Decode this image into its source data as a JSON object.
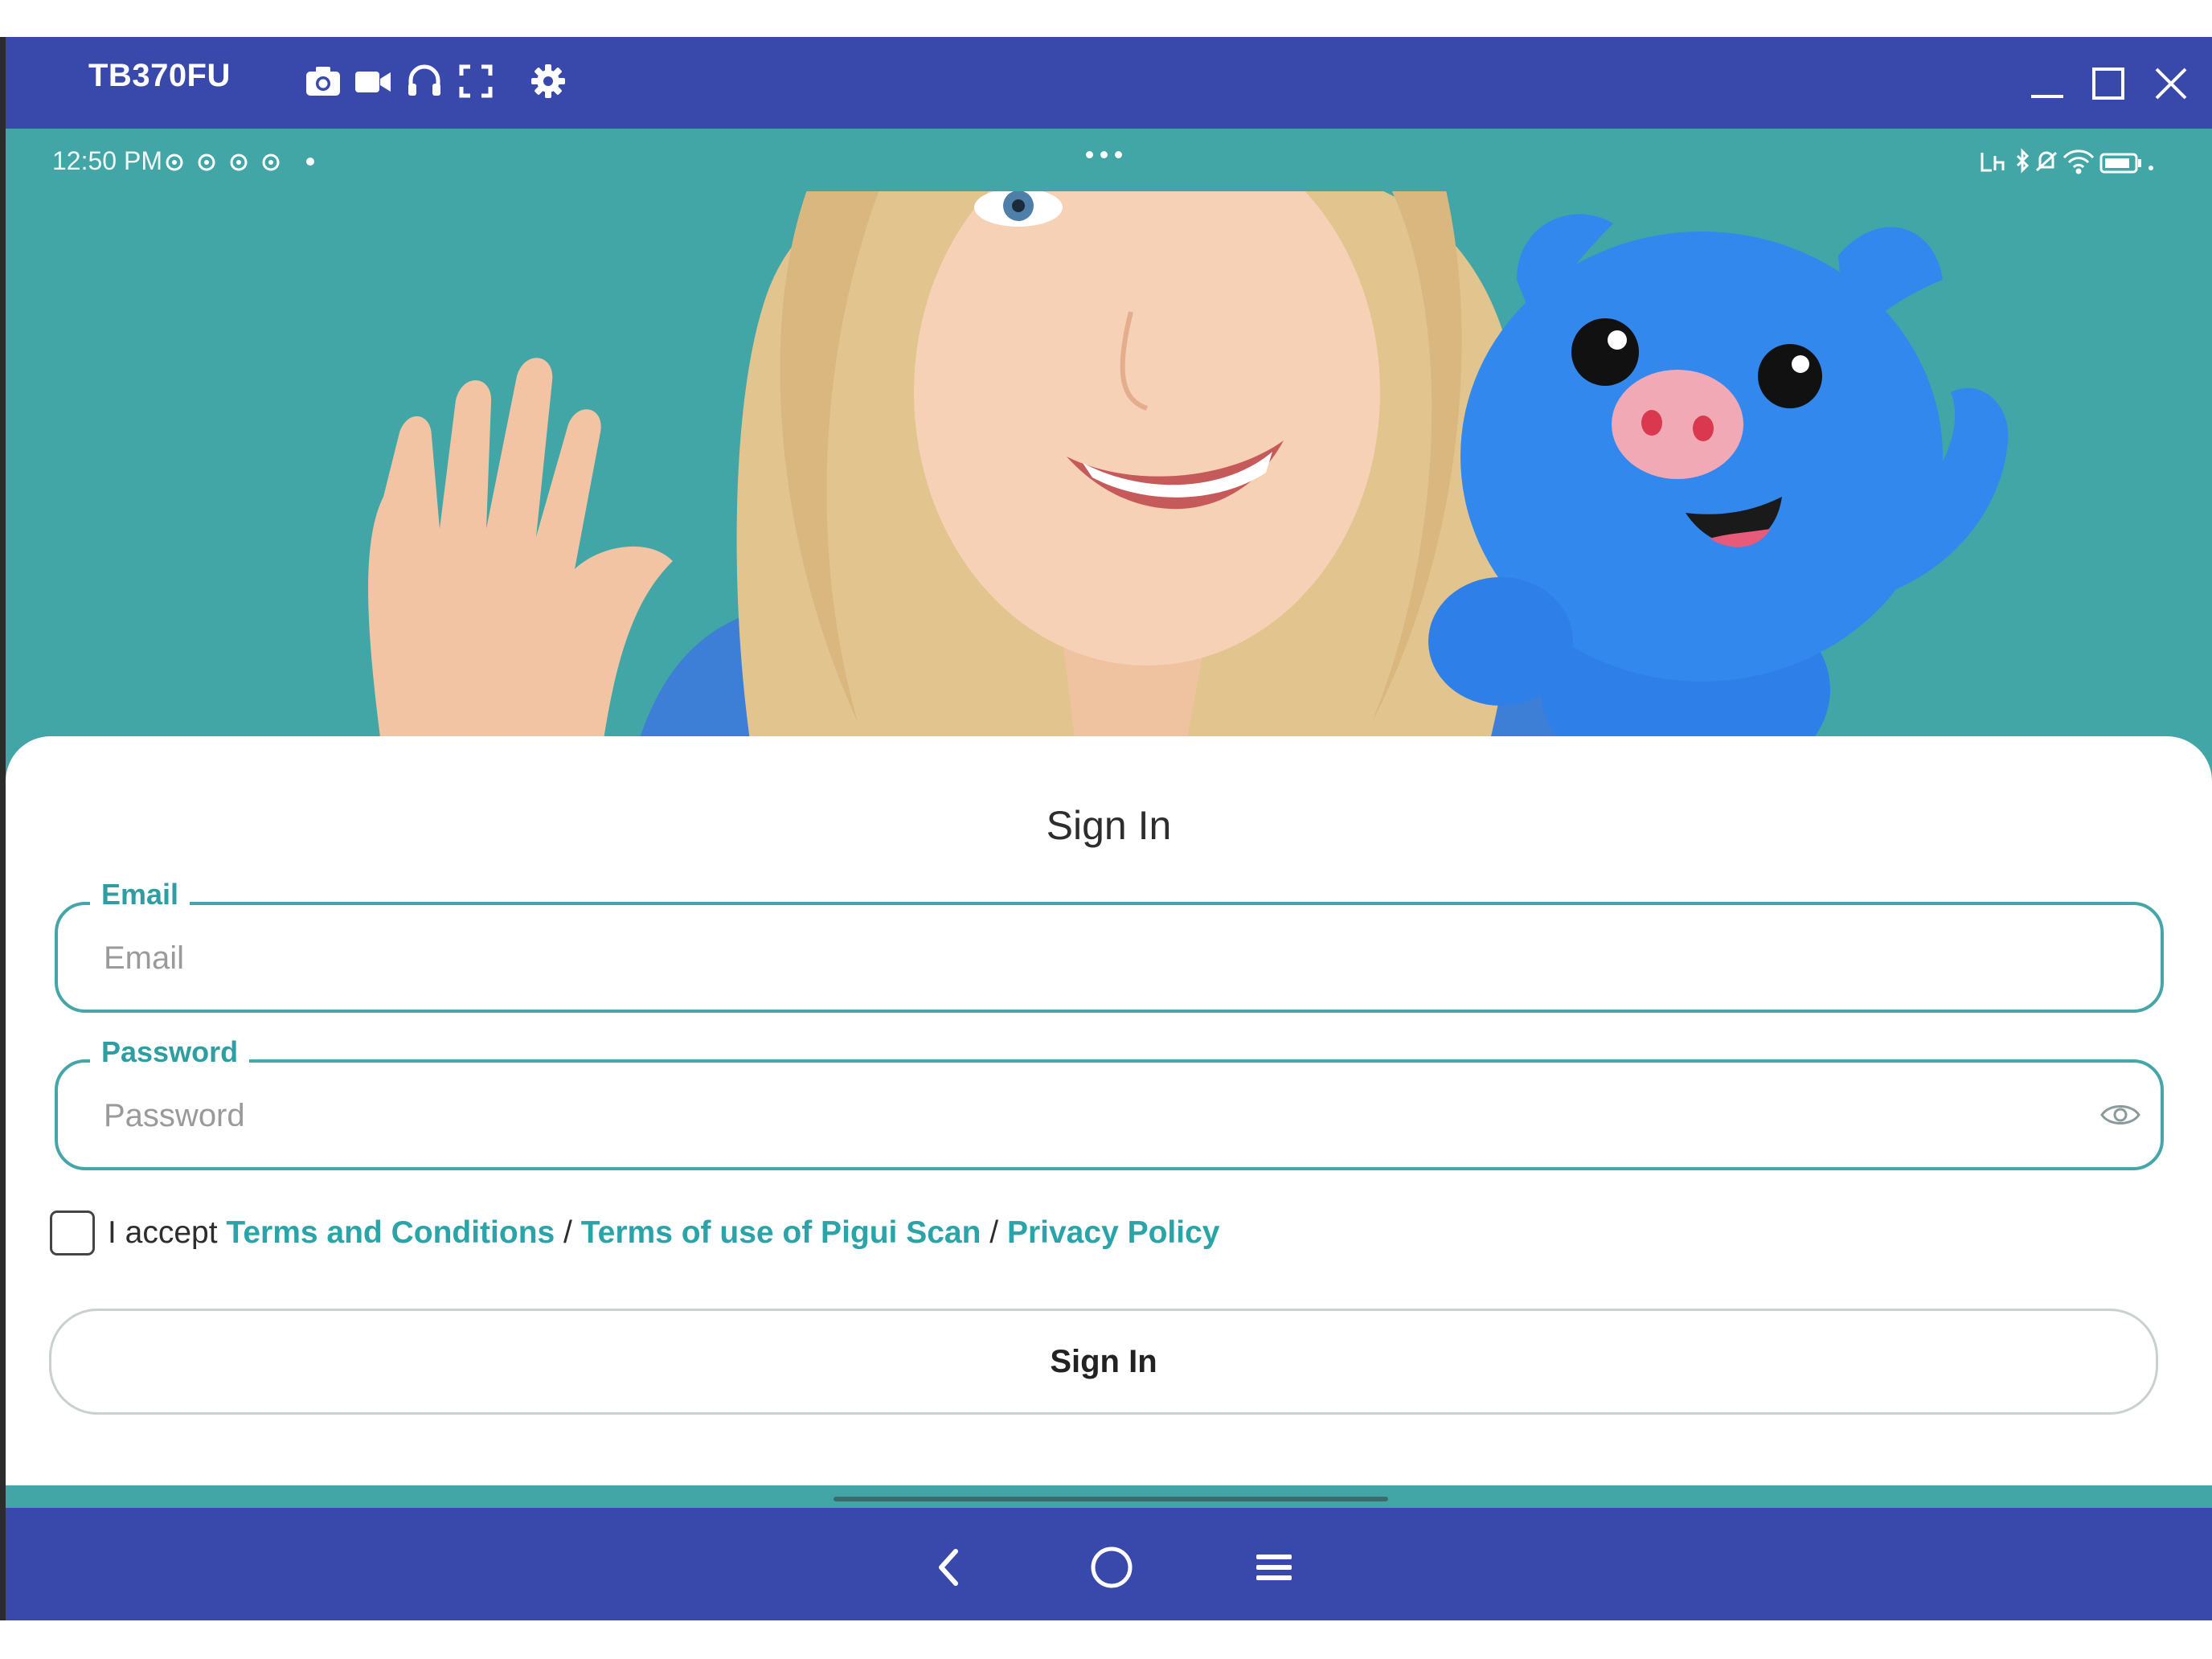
{
  "window": {
    "title": "TB370FU",
    "toolbar_icons": [
      "camera-icon",
      "video-camera-icon",
      "headphones-icon",
      "fullscreen-icon",
      "gear-icon"
    ],
    "controls": [
      "minimize-icon",
      "maximize-icon",
      "close-icon"
    ],
    "colors": {
      "titlebar": "#3949ab"
    }
  },
  "statusbar": {
    "time": "12:50 PM",
    "notification_icons": [
      "app-notification-icon",
      "app-notification-icon",
      "app-notification-icon",
      "app-notification-icon"
    ],
    "system_icons": [
      "lte-icon",
      "bluetooth-icon",
      "silent-icon",
      "wifi-icon",
      "battery-icon"
    ]
  },
  "hero": {
    "colors": {
      "background": "#42a6a6",
      "mascot": "#2f7fe8"
    }
  },
  "signin": {
    "title": "Sign In",
    "email": {
      "label": "Email",
      "placeholder": "Email",
      "value": ""
    },
    "password": {
      "label": "Password",
      "placeholder": "Password",
      "value": ""
    },
    "terms": {
      "checked": false,
      "prefix": "I accept ",
      "terms_link": "Terms and Conditions",
      "separator": " / ",
      "scan_link": "Terms of use of Pigui Scan",
      "privacy_link": "Privacy Policy"
    },
    "button_label": "Sign In",
    "colors": {
      "accent": "#2aa4a8",
      "card": "#ffffff"
    }
  },
  "navbar": {
    "buttons": [
      "back-icon",
      "home-icon",
      "menu-icon"
    ],
    "colors": {
      "background": "#3949ab"
    }
  }
}
